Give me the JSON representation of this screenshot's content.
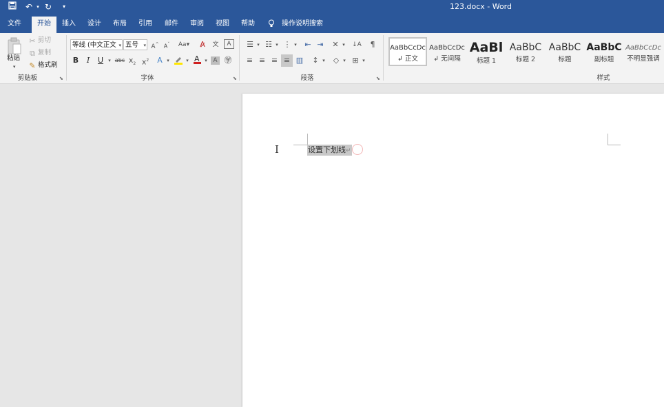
{
  "app": {
    "title": "123.docx  -  Word"
  },
  "quick_access": {
    "save_icon": "save-icon",
    "undo_icon": "undo-icon",
    "redo_icon": "redo-icon",
    "customize_icon": "customize-qat-icon"
  },
  "tabs": [
    {
      "label": "文件"
    },
    {
      "label": "开始"
    },
    {
      "label": "插入"
    },
    {
      "label": "设计"
    },
    {
      "label": "布局"
    },
    {
      "label": "引用"
    },
    {
      "label": "邮件"
    },
    {
      "label": "审阅"
    },
    {
      "label": "视图"
    },
    {
      "label": "帮助"
    }
  ],
  "active_tab": "开始",
  "tell_me": {
    "label": "操作说明搜索"
  },
  "clipboard": {
    "paste": "粘贴",
    "cut": "剪切",
    "copy": "复制",
    "format_painter": "格式刷",
    "group": "剪贴板"
  },
  "font": {
    "family": "等线 (中文正文",
    "size": "五号",
    "group": "字体"
  },
  "paragraph": {
    "group": "段落"
  },
  "styles": {
    "group": "样式",
    "items": [
      {
        "preview": "AaBbCcDc",
        "name": "↲ 正文"
      },
      {
        "preview": "AaBbCcDc",
        "name": "↲ 无间隔"
      },
      {
        "preview": "AaBl",
        "name": "标题 1"
      },
      {
        "preview": "AaBbC",
        "name": "标题 2"
      },
      {
        "preview": "AaBbC",
        "name": "标题"
      },
      {
        "preview": "AaBbC",
        "name": "副标题"
      },
      {
        "preview": "AaBbCcDc",
        "name": "不明显强调"
      }
    ]
  },
  "document": {
    "text": "设置下划线",
    "paragraph_mark": "↵"
  }
}
